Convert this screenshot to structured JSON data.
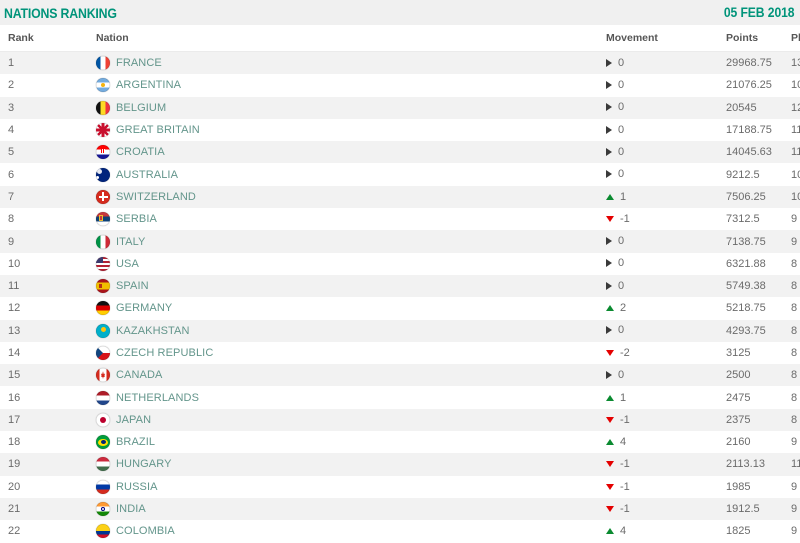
{
  "header": {
    "title": "NATIONS RANKING",
    "date": "05 FEB 2018",
    "title_color": "#00947a"
  },
  "table": {
    "columns": {
      "rank": "Rank",
      "nation": "Nation",
      "movement": "Movement",
      "points": "Points",
      "played": "Played"
    },
    "rows": [
      {
        "rank": "1",
        "nation": "FRANCE",
        "flag": "flag-france",
        "movement": "0",
        "movement_dir": "flat",
        "points": "29968.75",
        "played": "13"
      },
      {
        "rank": "2",
        "nation": "ARGENTINA",
        "flag": "flag-argentina",
        "movement": "0",
        "movement_dir": "flat",
        "points": "21076.25",
        "played": "10"
      },
      {
        "rank": "3",
        "nation": "BELGIUM",
        "flag": "flag-belgium",
        "movement": "0",
        "movement_dir": "flat",
        "points": "20545",
        "played": "12"
      },
      {
        "rank": "4",
        "nation": "GREAT BRITAIN",
        "flag": "flag-great-britain",
        "movement": "0",
        "movement_dir": "flat",
        "points": "17188.75",
        "played": "11"
      },
      {
        "rank": "5",
        "nation": "CROATIA",
        "flag": "flag-croatia",
        "movement": "0",
        "movement_dir": "flat",
        "points": "14045.63",
        "played": "11"
      },
      {
        "rank": "6",
        "nation": "AUSTRALIA",
        "flag": "flag-australia",
        "movement": "0",
        "movement_dir": "flat",
        "points": "9212.5",
        "played": "10"
      },
      {
        "rank": "7",
        "nation": "SWITZERLAND",
        "flag": "flag-switzerland",
        "movement": "1",
        "movement_dir": "up",
        "points": "7506.25",
        "played": "10"
      },
      {
        "rank": "8",
        "nation": "SERBIA",
        "flag": "flag-serbia",
        "movement": "-1",
        "movement_dir": "down",
        "points": "7312.5",
        "played": "9"
      },
      {
        "rank": "9",
        "nation": "ITALY",
        "flag": "flag-italy",
        "movement": "0",
        "movement_dir": "flat",
        "points": "7138.75",
        "played": "9"
      },
      {
        "rank": "10",
        "nation": "USA",
        "flag": "flag-usa",
        "movement": "0",
        "movement_dir": "flat",
        "points": "6321.88",
        "played": "8"
      },
      {
        "rank": "11",
        "nation": "SPAIN",
        "flag": "flag-spain",
        "movement": "0",
        "movement_dir": "flat",
        "points": "5749.38",
        "played": "8"
      },
      {
        "rank": "12",
        "nation": "GERMANY",
        "flag": "flag-germany",
        "movement": "2",
        "movement_dir": "up",
        "points": "5218.75",
        "played": "8"
      },
      {
        "rank": "13",
        "nation": "KAZAKHSTAN",
        "flag": "flag-kazakhstan",
        "movement": "0",
        "movement_dir": "flat",
        "points": "4293.75",
        "played": "8"
      },
      {
        "rank": "14",
        "nation": "CZECH REPUBLIC",
        "flag": "flag-czech-republic",
        "movement": "-2",
        "movement_dir": "down",
        "points": "3125",
        "played": "8"
      },
      {
        "rank": "15",
        "nation": "CANADA",
        "flag": "flag-canada",
        "movement": "0",
        "movement_dir": "flat",
        "points": "2500",
        "played": "8"
      },
      {
        "rank": "16",
        "nation": "NETHERLANDS",
        "flag": "flag-netherlands",
        "movement": "1",
        "movement_dir": "up",
        "points": "2475",
        "played": "8"
      },
      {
        "rank": "17",
        "nation": "JAPAN",
        "flag": "flag-japan",
        "movement": "-1",
        "movement_dir": "down",
        "points": "2375",
        "played": "8"
      },
      {
        "rank": "18",
        "nation": "BRAZIL",
        "flag": "flag-brazil",
        "movement": "4",
        "movement_dir": "up",
        "points": "2160",
        "played": "9"
      },
      {
        "rank": "19",
        "nation": "HUNGARY",
        "flag": "flag-hungary",
        "movement": "-1",
        "movement_dir": "down",
        "points": "2113.13",
        "played": "11"
      },
      {
        "rank": "20",
        "nation": "RUSSIA",
        "flag": "flag-russia",
        "movement": "-1",
        "movement_dir": "down",
        "points": "1985",
        "played": "9"
      },
      {
        "rank": "21",
        "nation": "INDIA",
        "flag": "flag-india",
        "movement": "-1",
        "movement_dir": "down",
        "points": "1912.5",
        "played": "9"
      },
      {
        "rank": "22",
        "nation": "COLOMBIA",
        "flag": "flag-colombia",
        "movement": "4",
        "movement_dir": "up",
        "points": "1825",
        "played": "9"
      }
    ]
  }
}
